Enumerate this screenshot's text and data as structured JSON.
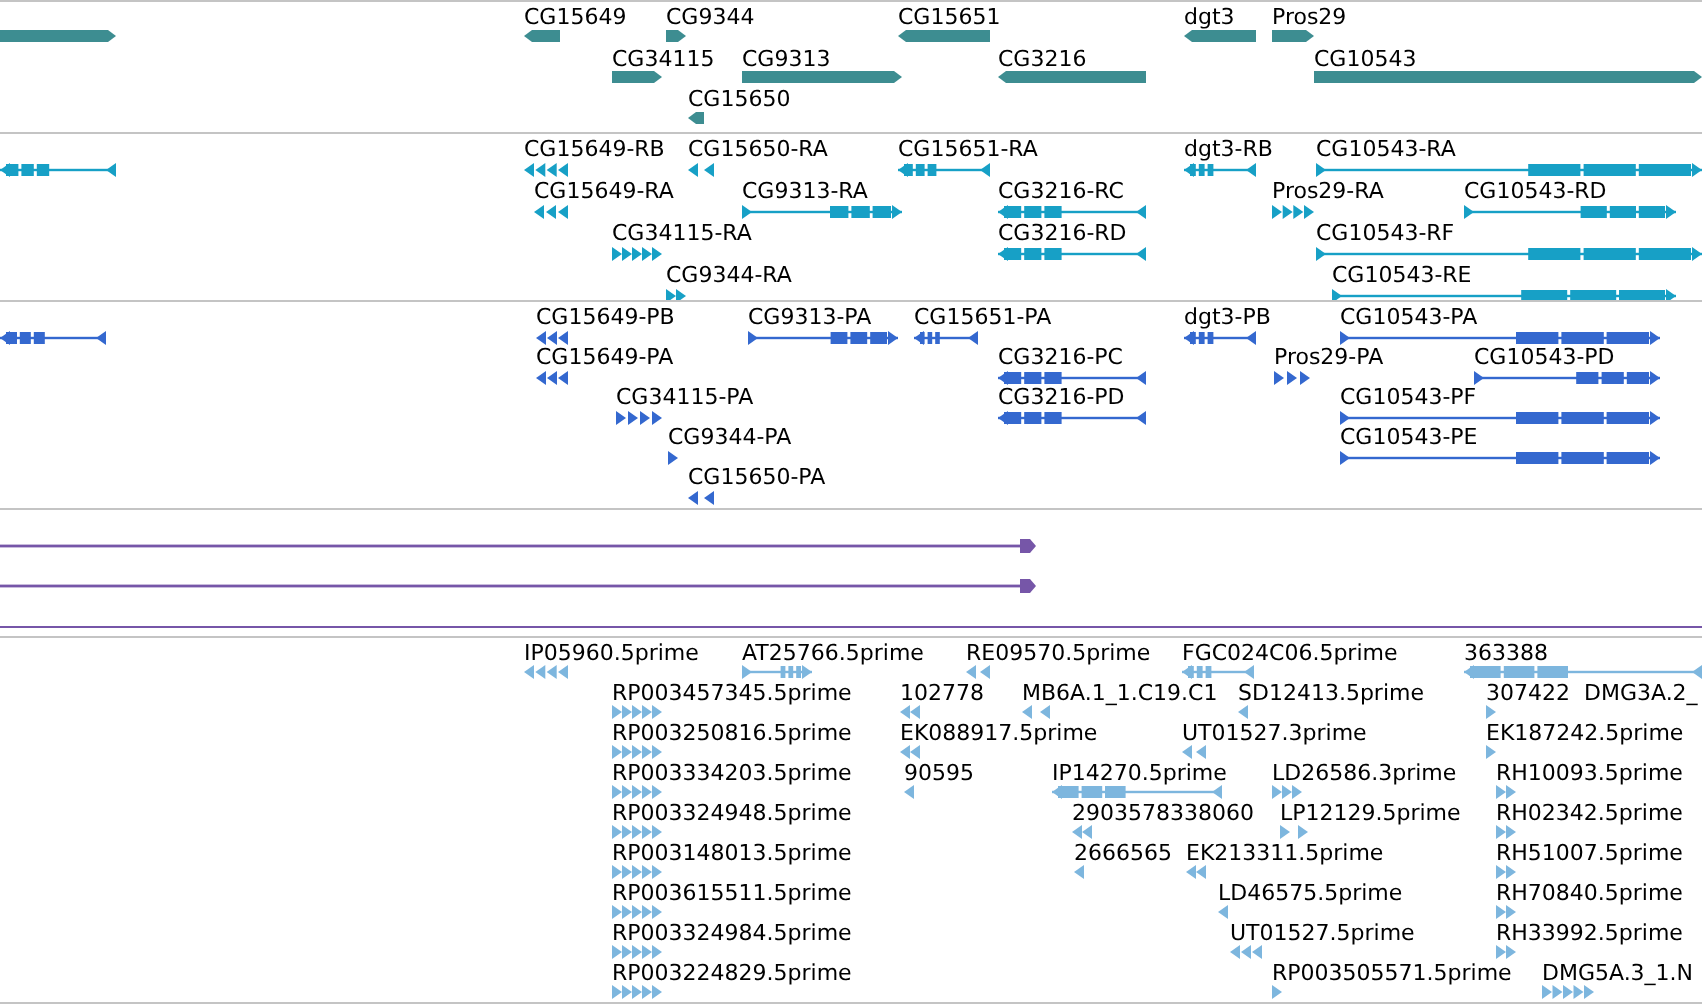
{
  "tracks": [
    {
      "kind": "gene",
      "color": "#3d8d91",
      "features": [
        {
          "reverse": false
        },
        {
          "label": "CG15649",
          "reverse": true
        },
        {
          "label": "CG9344",
          "reverse": false
        },
        {
          "label": "CG15651",
          "reverse": true
        },
        {
          "label": "dgt3",
          "reverse": true
        },
        {
          "label": "Pros29",
          "reverse": false
        },
        {
          "label": "CG34115",
          "reverse": false
        },
        {
          "label": "CG9313",
          "reverse": false
        },
        {
          "label": "CG3216",
          "reverse": true
        },
        {
          "label": "CG10543",
          "reverse": false
        },
        {
          "label": "CG15650",
          "reverse": true
        }
      ]
    },
    {
      "kind": "transcript",
      "color": "#17a0c6",
      "features": [
        {
          "reverse": true
        },
        {
          "label": "CG15649-RB",
          "reverse": true
        },
        {
          "label": "CG15650-RA",
          "reverse": true
        },
        {
          "label": "CG15651-RA",
          "reverse": true
        },
        {
          "label": "dgt3-RB",
          "reverse": true
        },
        {
          "label": "CG10543-RA",
          "reverse": false
        },
        {
          "label": "CG15649-RA",
          "reverse": true
        },
        {
          "label": "CG9313-RA",
          "reverse": false
        },
        {
          "label": "CG3216-RC",
          "reverse": true
        },
        {
          "label": "Pros29-RA",
          "reverse": false
        },
        {
          "label": "CG10543-RD",
          "reverse": false
        },
        {
          "label": "CG34115-RA",
          "reverse": false
        },
        {
          "label": "CG3216-RD",
          "reverse": true
        },
        {
          "label": "CG10543-RF",
          "reverse": false
        },
        {
          "label": "CG9344-RA",
          "reverse": false
        },
        {
          "label": "CG10543-RE",
          "reverse": false
        }
      ]
    },
    {
      "kind": "protein",
      "color": "#3468cf",
      "features": [
        {
          "reverse": true
        },
        {
          "label": "CG15649-PB",
          "reverse": true
        },
        {
          "label": "CG9313-PA",
          "reverse": false
        },
        {
          "label": "CG15651-PA",
          "reverse": true
        },
        {
          "label": "dgt3-PB",
          "reverse": true
        },
        {
          "label": "CG10543-PA",
          "reverse": false
        },
        {
          "label": "CG15649-PA",
          "reverse": true
        },
        {
          "label": "CG3216-PC",
          "reverse": true
        },
        {
          "label": "Pros29-PA",
          "reverse": false
        },
        {
          "label": "CG10543-PD",
          "reverse": false
        },
        {
          "label": "CG34115-PA",
          "reverse": false
        },
        {
          "label": "CG3216-PD",
          "reverse": true
        },
        {
          "label": "CG10543-PF",
          "reverse": false
        },
        {
          "label": "CG9344-PA",
          "reverse": false
        },
        {
          "label": "CG10543-PE",
          "reverse": false
        },
        {
          "label": "CG15650-PA",
          "reverse": true
        }
      ]
    },
    {
      "kind": "line",
      "color": "#7656a8",
      "features": [
        {
          "reverse": false
        },
        {
          "reverse": false
        }
      ]
    },
    {
      "kind": "est",
      "color": "#7db6de",
      "features": [
        {
          "label": "IP05960.5prime",
          "reverse": true
        },
        {
          "label": "AT25766.5prime",
          "reverse": false
        },
        {
          "label": "RE09570.5prime",
          "reverse": true
        },
        {
          "label": "FGC024C06.5prime",
          "reverse": true
        },
        {
          "label": "363388",
          "reverse": true
        },
        {
          "label": "RP003457345.5prime",
          "reverse": false
        },
        {
          "label": "102778",
          "reverse": true
        },
        {
          "label": "MB6A.1_1.C19.C1",
          "reverse": true
        },
        {
          "label": "SD12413.5prime",
          "reverse": true
        },
        {
          "label": "307422",
          "reverse": false
        },
        {
          "label": "DMG3A.2_"
        },
        {
          "label": "RP003250816.5prime",
          "reverse": false
        },
        {
          "label": "EK088917.5prime",
          "reverse": true
        },
        {
          "label": "UT01527.3prime",
          "reverse": true
        },
        {
          "label": "EK187242.5prime",
          "reverse": false
        },
        {
          "label": "RP003334203.5prime",
          "reverse": false
        },
        {
          "label": "90595",
          "reverse": true
        },
        {
          "label": "IP14270.5prime",
          "reverse": true
        },
        {
          "label": "LD26586.3prime",
          "reverse": false
        },
        {
          "label": "RH10093.5prime",
          "reverse": false
        },
        {
          "label": "RP003324948.5prime",
          "reverse": false
        },
        {
          "label": "2903578338060",
          "reverse": true
        },
        {
          "label": "LP12129.5prime",
          "reverse": false
        },
        {
          "label": "RH02342.5prime",
          "reverse": false
        },
        {
          "label": "RP003148013.5prime",
          "reverse": false
        },
        {
          "label": "2666565",
          "reverse": true
        },
        {
          "label": "EK213311.5prime",
          "reverse": true
        },
        {
          "label": "RH51007.5prime",
          "reverse": false
        },
        {
          "label": "RP003615511.5prime",
          "reverse": false
        },
        {
          "label": "LD46575.5prime",
          "reverse": true
        },
        {
          "label": "RH70840.5prime",
          "reverse": false
        },
        {
          "label": "RP003324984.5prime",
          "reverse": false
        },
        {
          "label": "UT01527.5prime",
          "reverse": true
        },
        {
          "label": "RH33992.5prime",
          "reverse": false
        },
        {
          "label": "RP003224829.5prime",
          "reverse": false
        },
        {
          "label": "RP003505571.5prime",
          "reverse": false
        },
        {
          "label": "DMG5A.3_1.N",
          "reverse": false
        }
      ]
    }
  ]
}
